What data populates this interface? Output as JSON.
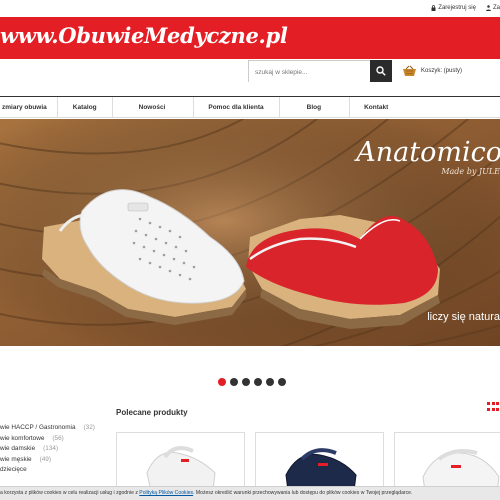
{
  "topbar": {
    "register": "Zarejestruj się",
    "login_partial": "Za"
  },
  "header": {
    "logo_text": "www.ObuwieMedyczne.pl",
    "search_placeholder": "szukaj w sklepie...",
    "cart_label": "Koszyk: (pusty)"
  },
  "nav": {
    "items": [
      {
        "label": "zmiary obuwia"
      },
      {
        "label": "Katalog"
      },
      {
        "label": "Nowości"
      },
      {
        "label": "Pomoc dla klienta"
      },
      {
        "label": "Blog"
      },
      {
        "label": "Kontakt"
      }
    ]
  },
  "hero": {
    "brand": "Anatomico",
    "subtitle": "Made by JULE",
    "tagline": "liczy się natura"
  },
  "slider": {
    "count": 6,
    "active_index": 0
  },
  "categories": [
    {
      "name": "wie HACCP / Gastronomia",
      "count": "(32)"
    },
    {
      "name": "wie komfortowe",
      "count": "(56)"
    },
    {
      "name": "wie damskie",
      "count": "(134)"
    },
    {
      "name": "wie męskie",
      "count": "(49)"
    },
    {
      "name": "dziecięce",
      "count": ""
    }
  ],
  "recommended": {
    "title": "Polecane produkty"
  },
  "cookie": {
    "text_before": "a korzysta z plików cookies w celu realizacji usług i zgodnie z ",
    "link": "Polityką Plików Cookies",
    "text_after": ". Możesz określić warunki przechowywania lub dostępu do plików cookies w Twojej przeglądarce."
  },
  "colors": {
    "brand_red": "#e31e24",
    "dark": "#2b2b2b"
  }
}
